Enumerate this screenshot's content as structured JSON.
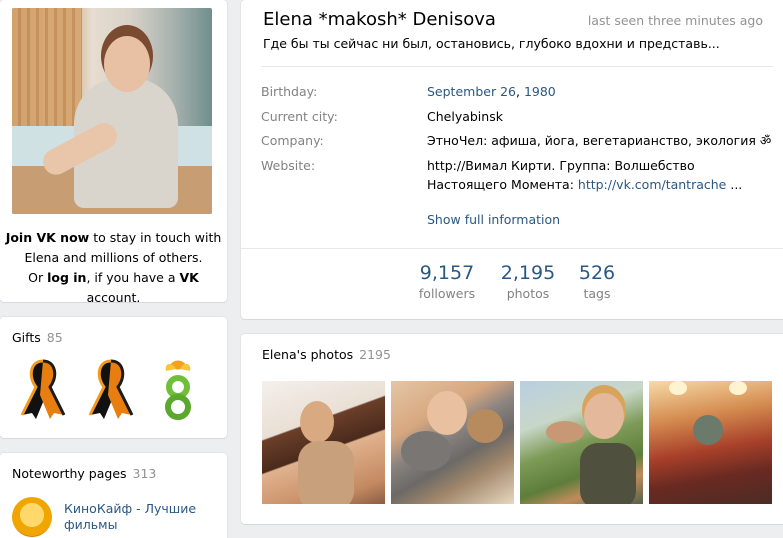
{
  "profile": {
    "name": "Elena *makosh* Denisova",
    "last_seen": "last seen three minutes ago",
    "status": "Где бы ты сейчас ни был, остановись, глубоко вдохни и представь..."
  },
  "join": {
    "line1_bold": "Join VK now",
    "line1_rest": " to stay in touch with",
    "line2": "Elena and millions of others.",
    "line3_pre": "Or ",
    "login_link": "log in",
    "line3_mid": ", if you have a ",
    "vk_bold": "VK",
    "line3_end": " account."
  },
  "info": {
    "birthday_label": "Birthday:",
    "birthday_date": "September 26",
    "birthday_sep": ", ",
    "birthday_year": "1980",
    "city_label": "Current city:",
    "city_value": "Chelyabinsk",
    "company_label": "Company:",
    "company_value": "ЭтноЧел: афиша, йога, вегетарианство, экология ॐ",
    "website_label": "Website:",
    "website_text": "http://Вимал Кирти. Группа: Волшебство Настоящего Момента: ",
    "website_link": "http://vk.com/tantrache",
    "website_ellipsis": " ...",
    "show_full": "Show full information"
  },
  "counters": [
    {
      "num": "9,157",
      "label": "followers"
    },
    {
      "num": "2,195",
      "label": "photos"
    },
    {
      "num": "526",
      "label": "tags"
    }
  ],
  "gifts": {
    "title": "Gifts",
    "count": "85",
    "icons": [
      "st-george-ribbon-icon",
      "st-george-ribbon-icon",
      "flower-eight-icon"
    ]
  },
  "pages": {
    "title": "Noteworthy pages",
    "count": "313",
    "items": [
      {
        "name": "КиноКайф - Лучшие фильмы",
        "icon": "popcorn-icon"
      }
    ]
  },
  "photos": {
    "title": "Elena's photos",
    "count": "2195"
  },
  "colors": {
    "link": "#2a5885",
    "muted": "#828282",
    "background": "#edeef0"
  }
}
